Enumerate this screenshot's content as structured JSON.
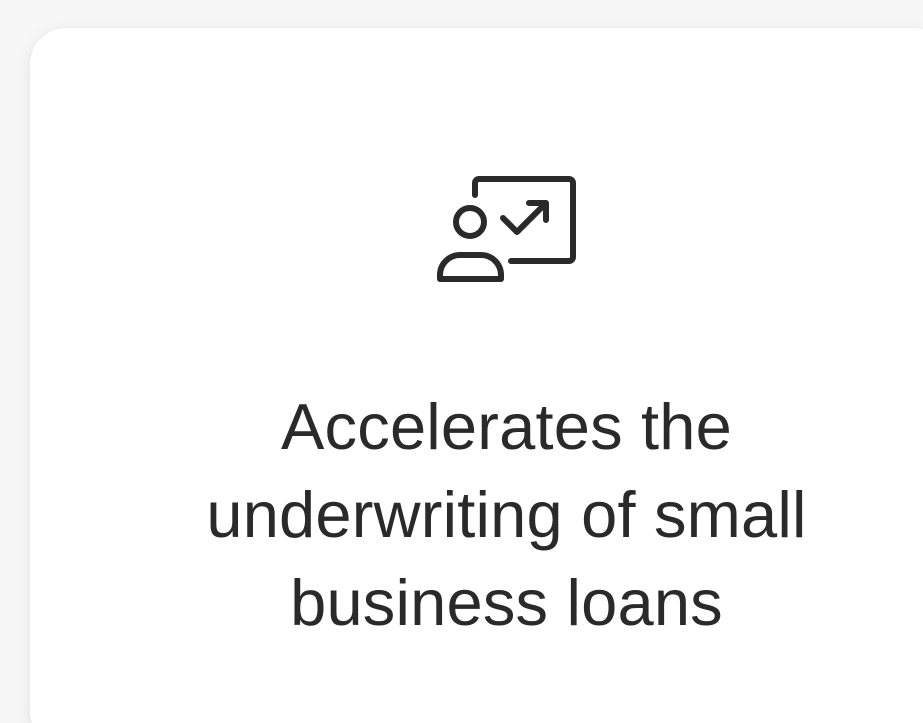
{
  "card": {
    "icon": "presentation-growth-icon",
    "text_lines": [
      "Accelerates the",
      "underwriting of small",
      "business loans"
    ]
  },
  "colors": {
    "background": "#f7f7f7",
    "card_background": "#ffffff",
    "text": "#2a2a2a",
    "icon_stroke": "#2a2a2a"
  }
}
